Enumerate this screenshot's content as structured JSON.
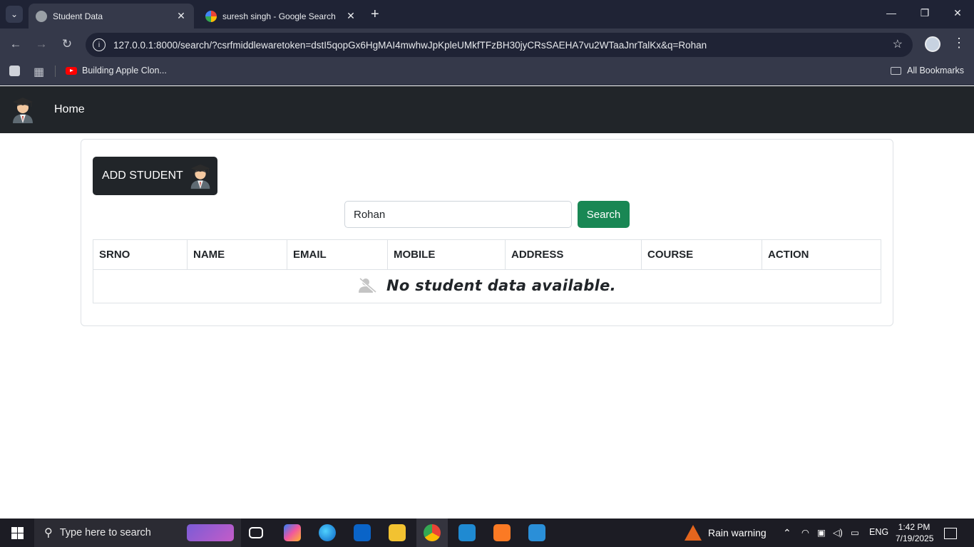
{
  "browser": {
    "tabs": [
      {
        "title": "Student Data",
        "active": true
      },
      {
        "title": "suresh singh - Google Search",
        "active": false
      }
    ],
    "url": "127.0.0.1:8000/search/?csrfmiddlewaretoken=dstI5qopGx6HgMAI4mwhwJpKpleUMkfTFzBH30jyCRsSAEHA7vu2WTaaJnrTalKx&q=Rohan",
    "bookmarks": [
      {
        "label": "Building Apple Clon..."
      }
    ],
    "all_bookmarks_label": "All Bookmarks"
  },
  "app": {
    "nav": {
      "home_label": "Home"
    },
    "add_student_label": "ADD STUDENT",
    "search": {
      "value": "Rohan",
      "button_label": "Search"
    },
    "table": {
      "columns": [
        "SRNO",
        "NAME",
        "EMAIL",
        "MOBILE",
        "ADDRESS",
        "COURSE",
        "ACTION"
      ],
      "empty_message": "No student data available."
    }
  },
  "taskbar": {
    "search_placeholder": "Type here to search",
    "weather": "Rain warning",
    "language": "ENG",
    "time": "1:42 PM",
    "date": "7/19/2025"
  },
  "colors": {
    "navbar": "#212529",
    "search_button": "#198754",
    "add_button": "#212529"
  }
}
